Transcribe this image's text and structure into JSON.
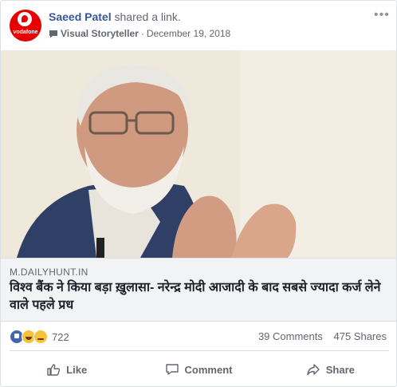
{
  "post": {
    "author": "Saeed Patel",
    "action": "shared a link.",
    "page_name": "Visual Storyteller",
    "separator": "·",
    "date": "December 19, 2018",
    "avatar_text": "vodafone"
  },
  "link": {
    "domain": "M.DAILYHUNT.IN",
    "headline": "विश्व बैंक ने किया बड़ा ख़ुलासा- नरेन्द्र मोदी आजादी के बाद सबसे ज्यादा कर्ज लेने वाले पहले प्रध"
  },
  "engagement": {
    "reaction_count": "722",
    "comments": "39 Comments",
    "shares": "475 Shares",
    "reactions": [
      "like-icon",
      "haha-icon",
      "sad-icon"
    ]
  },
  "actions": {
    "like": "Like",
    "comment": "Comment",
    "share": "Share"
  },
  "colors": {
    "link_blue": "#365899",
    "meta_gray": "#616770",
    "brand_red": "#e60000"
  }
}
